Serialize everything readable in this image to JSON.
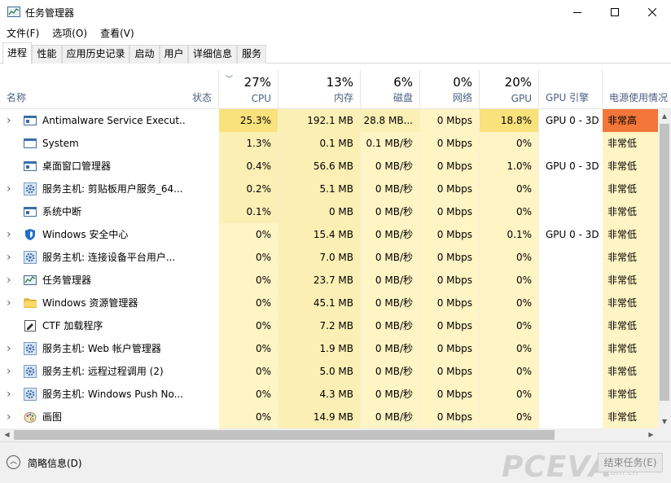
{
  "window": {
    "title": "任务管理器",
    "min": "—",
    "max": "☐",
    "close": "✕"
  },
  "menu": [
    "文件(F)",
    "选项(O)",
    "查看(V)"
  ],
  "tabs": [
    "进程",
    "性能",
    "应用历史记录",
    "启动",
    "用户",
    "详细信息",
    "服务"
  ],
  "active_tab": "进程",
  "columns": {
    "name": "名称",
    "status": "状态",
    "cpu": {
      "pct": "27%",
      "label": "CPU"
    },
    "memory": {
      "pct": "13%",
      "label": "内存"
    },
    "disk": {
      "pct": "6%",
      "label": "磁盘"
    },
    "network": {
      "pct": "0%",
      "label": "网络"
    },
    "gpu": {
      "pct": "20%",
      "label": "GPU"
    },
    "gpu_engine": "GPU 引擎",
    "power": "电源使用情况"
  },
  "rows": [
    {
      "name": "Antimalware Service Execut...",
      "expand": true,
      "icon": "service-window-icon",
      "cpu": "25.3%",
      "mem": "192.1 MB",
      "disk": "28.8 MB...",
      "net": "0 Mbps",
      "gpu": "18.8%",
      "engine": "GPU 0 - 3D",
      "power": "非常高"
    },
    {
      "name": "System",
      "expand": false,
      "icon": "blank-icon",
      "cpu": "1.3%",
      "mem": "0.1 MB",
      "disk": "0.1 MB/秒",
      "net": "0 Mbps",
      "gpu": "0%",
      "engine": "",
      "power": "非常低"
    },
    {
      "name": "桌面窗口管理器",
      "expand": false,
      "icon": "service-window-icon",
      "cpu": "0.4%",
      "mem": "56.6 MB",
      "disk": "0 MB/秒",
      "net": "0 Mbps",
      "gpu": "1.0%",
      "engine": "GPU 0 - 3D",
      "power": "非常低"
    },
    {
      "name": "服务主机: 剪贴板用户服务_64...",
      "expand": true,
      "icon": "gear-icon",
      "cpu": "0.2%",
      "mem": "5.1 MB",
      "disk": "0 MB/秒",
      "net": "0 Mbps",
      "gpu": "0%",
      "engine": "",
      "power": "非常低"
    },
    {
      "name": "系统中断",
      "expand": false,
      "icon": "service-window-icon",
      "cpu": "0.1%",
      "mem": "0 MB",
      "disk": "0 MB/秒",
      "net": "0 Mbps",
      "gpu": "0%",
      "engine": "",
      "power": "非常低"
    },
    {
      "name": "Windows 安全中心",
      "expand": true,
      "icon": "shield-icon",
      "cpu": "0%",
      "mem": "15.4 MB",
      "disk": "0 MB/秒",
      "net": "0 Mbps",
      "gpu": "0.1%",
      "engine": "GPU 0 - 3D",
      "power": "非常低"
    },
    {
      "name": "服务主机: 连接设备平台用户...",
      "expand": true,
      "icon": "gear-icon",
      "cpu": "0%",
      "mem": "7.0 MB",
      "disk": "0 MB/秒",
      "net": "0 Mbps",
      "gpu": "0%",
      "engine": "",
      "power": "非常低"
    },
    {
      "name": "任务管理器",
      "expand": true,
      "icon": "task-manager-icon",
      "cpu": "0%",
      "mem": "23.7 MB",
      "disk": "0 MB/秒",
      "net": "0 Mbps",
      "gpu": "0%",
      "engine": "",
      "power": "非常低"
    },
    {
      "name": "Windows 资源管理器",
      "expand": true,
      "icon": "folder-icon",
      "cpu": "0%",
      "mem": "45.1 MB",
      "disk": "0 MB/秒",
      "net": "0 Mbps",
      "gpu": "0%",
      "engine": "",
      "power": "非常低"
    },
    {
      "name": "CTF 加载程序",
      "expand": false,
      "icon": "ctf-icon",
      "cpu": "0%",
      "mem": "7.2 MB",
      "disk": "0 MB/秒",
      "net": "0 Mbps",
      "gpu": "0%",
      "engine": "",
      "power": "非常低"
    },
    {
      "name": "服务主机: Web 帐户管理器",
      "expand": true,
      "icon": "gear-icon",
      "cpu": "0%",
      "mem": "1.9 MB",
      "disk": "0 MB/秒",
      "net": "0 Mbps",
      "gpu": "0%",
      "engine": "",
      "power": "非常低"
    },
    {
      "name": "服务主机: 远程过程调用 (2)",
      "expand": true,
      "icon": "gear-icon",
      "cpu": "0%",
      "mem": "5.0 MB",
      "disk": "0 MB/秒",
      "net": "0 Mbps",
      "gpu": "0%",
      "engine": "",
      "power": "非常低"
    },
    {
      "name": "服务主机: Windows Push No...",
      "expand": true,
      "icon": "gear-icon",
      "cpu": "0%",
      "mem": "4.3 MB",
      "disk": "0 MB/秒",
      "net": "0 Mbps",
      "gpu": "0%",
      "engine": "",
      "power": "非常低"
    },
    {
      "name": "画图",
      "expand": true,
      "icon": "paint-icon",
      "cpu": "0%",
      "mem": "14.9 MB",
      "disk": "0 MB/秒",
      "net": "0 Mbps",
      "gpu": "0%",
      "engine": "",
      "power": "非常低"
    }
  ],
  "footer": {
    "fewer_details": "简略信息(D)",
    "end_task": "结束任务(E)",
    "watermark": "PCEVA",
    "watermark_sub": ".com.cn"
  },
  "colors": {
    "heat_high": "#f9e17b",
    "heat_mid": "#fcefb4",
    "heat_low": "#fff4c4",
    "power_very_high": "#f3773a",
    "power_very_low": "#fff4c4",
    "header_label": "#4d6082"
  }
}
